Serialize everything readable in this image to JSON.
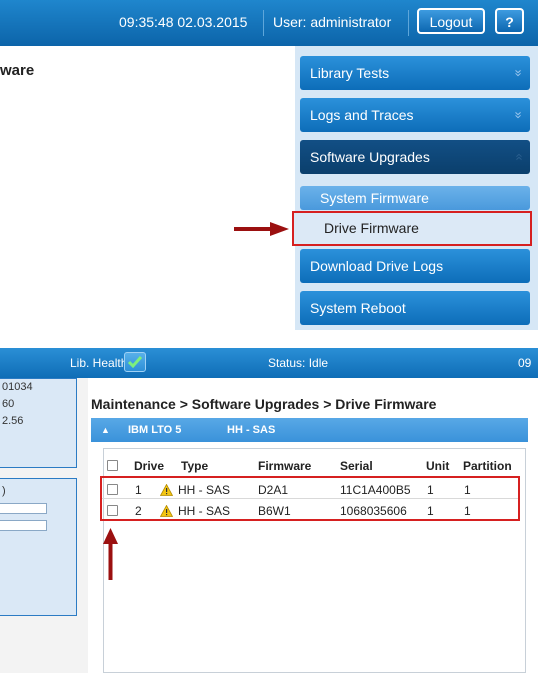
{
  "top": {
    "datetime": "09:35:48  02.03.2015",
    "user": "User: administrator",
    "logout_label": "Logout",
    "help_label": "?",
    "partial_title": "ware",
    "menu": {
      "items": [
        {
          "label": "Library Tests",
          "chevron": "»"
        },
        {
          "label": "Logs and Traces",
          "chevron": "»"
        },
        {
          "label": "Software Upgrades",
          "chevron": "»"
        }
      ],
      "sub_items": [
        {
          "label": "System Firmware"
        },
        {
          "label": "Drive Firmware"
        }
      ],
      "after_items": [
        {
          "label": "Download Drive Logs"
        },
        {
          "label": "System Reboot"
        }
      ]
    }
  },
  "bottom": {
    "lib_health_label": "Lib. Health:",
    "status": "Status:  Idle",
    "time_partial": "09",
    "left_panel": {
      "lines": [
        "01034",
        "60",
        "2.56"
      ],
      "box2_label": ")"
    },
    "breadcrumb": "Maintenance > Software Upgrades > Drive Firmware",
    "library": {
      "name": "IBM LTO 5",
      "type": "HH - SAS",
      "toggle": "▲"
    },
    "table": {
      "headers": [
        "Drive",
        "Type",
        "Firmware",
        "Serial",
        "Unit",
        "Partition"
      ],
      "rows": [
        {
          "drive": "1",
          "type": "HH - SAS",
          "firmware": "D2A1",
          "serial": "11C1A400B5",
          "unit": "1",
          "partition": "1"
        },
        {
          "drive": "2",
          "type": "HH - SAS",
          "firmware": "B6W1",
          "serial": "1068035606",
          "unit": "1",
          "partition": "1"
        }
      ]
    }
  },
  "colors": {
    "header_blue": "#0c64a9",
    "menu_blue": "#1a7fcb",
    "highlight_red": "#d62020",
    "arrow_red": "#9b1010"
  }
}
